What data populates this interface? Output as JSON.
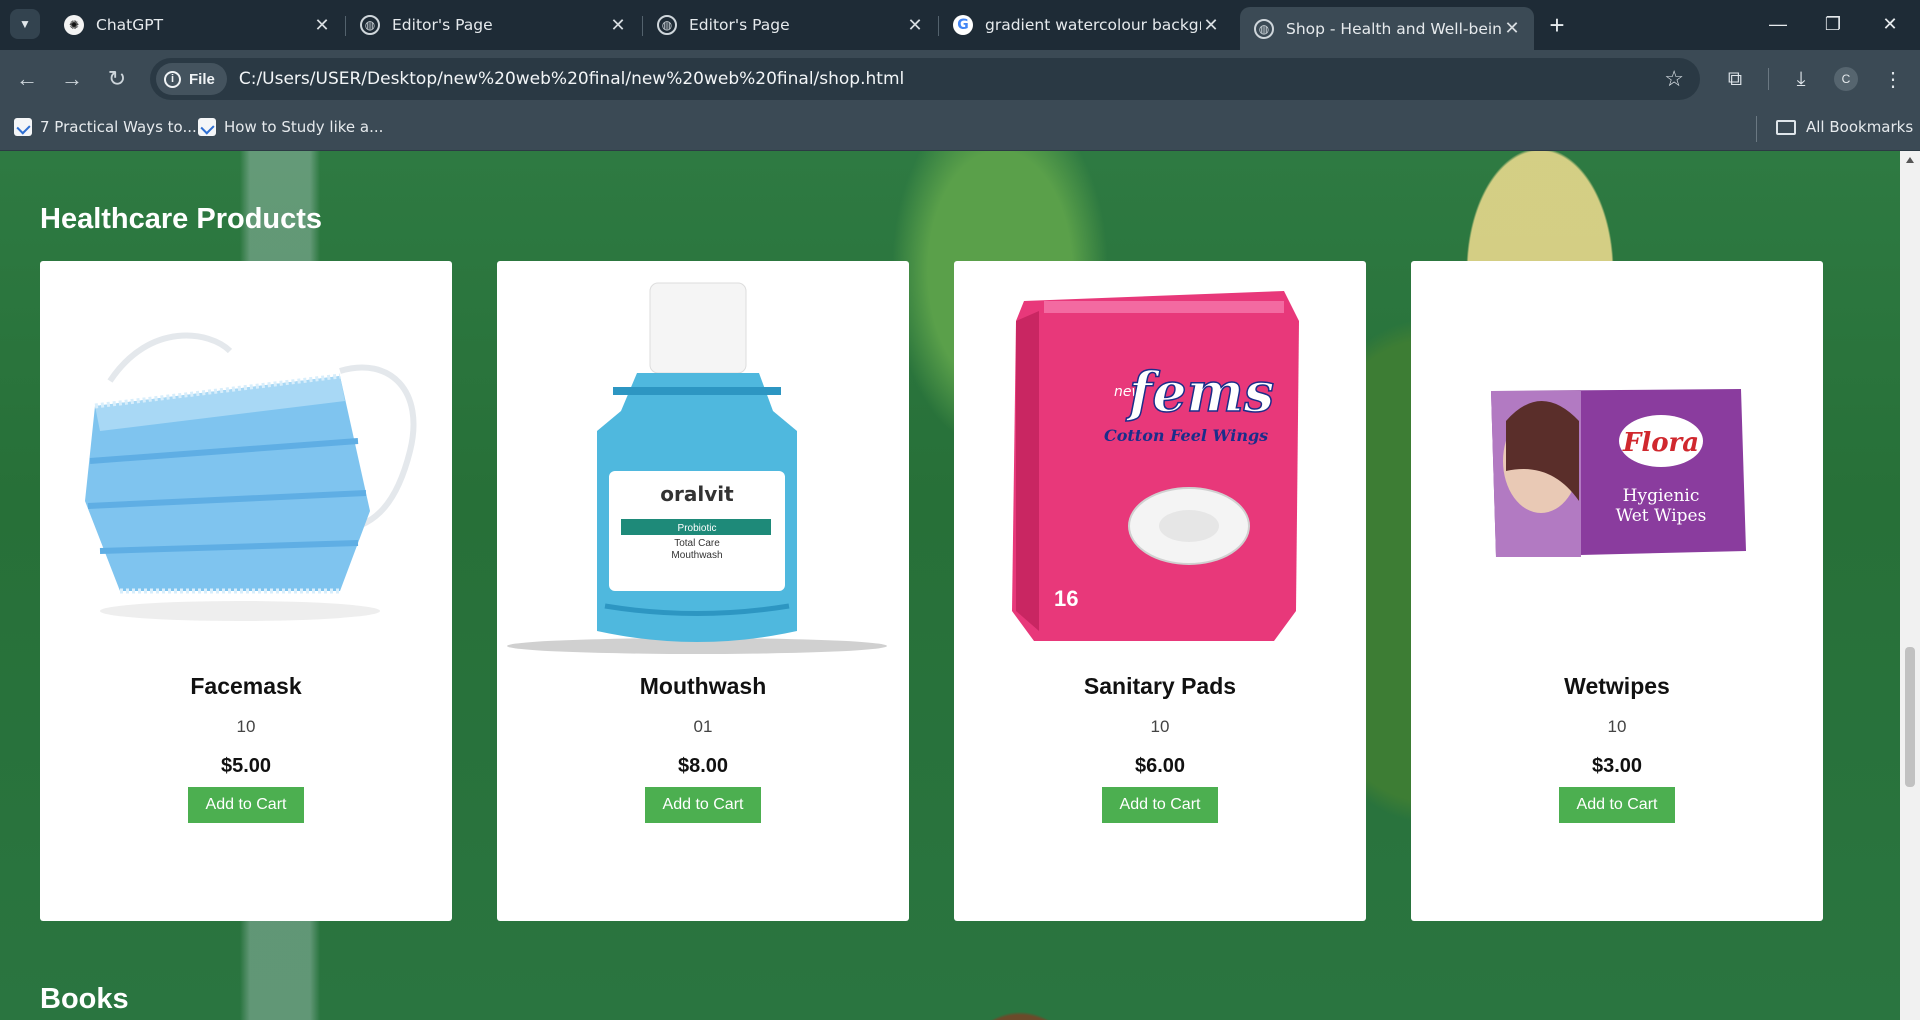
{
  "browser": {
    "tabs": [
      {
        "title": "ChatGPT",
        "icon": "chatgpt-icon"
      },
      {
        "title": "Editor's Page",
        "icon": "globe-icon"
      },
      {
        "title": "Editor's Page",
        "icon": "globe-icon"
      },
      {
        "title": "gradient watercolour backgrour",
        "icon": "google-icon"
      },
      {
        "title": "Shop - Health and Well-being",
        "icon": "globe-icon",
        "active": true
      }
    ],
    "address": {
      "scheme_label": "File",
      "url": "C:/Users/USER/Desktop/new%20web%20final/new%20web%20final/shop.html"
    },
    "profile_initial": "C",
    "bookmarks": [
      {
        "label": "7 Practical Ways to..."
      },
      {
        "label": "How to Study like a..."
      }
    ],
    "all_bookmarks_label": "All Bookmarks"
  },
  "page": {
    "sections": [
      {
        "title": "Healthcare Products",
        "products": [
          {
            "name": "Facemask",
            "qty": "10",
            "price": "$5.00",
            "button": "Add to Cart"
          },
          {
            "name": "Mouthwash",
            "qty": "01",
            "price": "$8.00",
            "button": "Add to Cart",
            "image_text": {
              "brand": "oralvit",
              "line1": "Probiotic",
              "line2": "Total Care",
              "line3": "Mouthwash"
            }
          },
          {
            "name": "Sanitary Pads",
            "qty": "10",
            "price": "$6.00",
            "button": "Add to Cart",
            "image_text": {
              "prefix": "new",
              "brand": "fems",
              "tagline": "Cotton Feel Wings",
              "count": "16"
            }
          },
          {
            "name": "Wetwipes",
            "qty": "10",
            "price": "$3.00",
            "button": "Add to Cart",
            "image_text": {
              "brand": "Flora",
              "line1": "Hygienic",
              "line2": "Wet Wipes"
            }
          }
        ]
      },
      {
        "title": "Books",
        "products": []
      }
    ]
  },
  "colors": {
    "button_green": "#4caf50",
    "page_background": "#2a7540",
    "card_background": "#ffffff"
  }
}
